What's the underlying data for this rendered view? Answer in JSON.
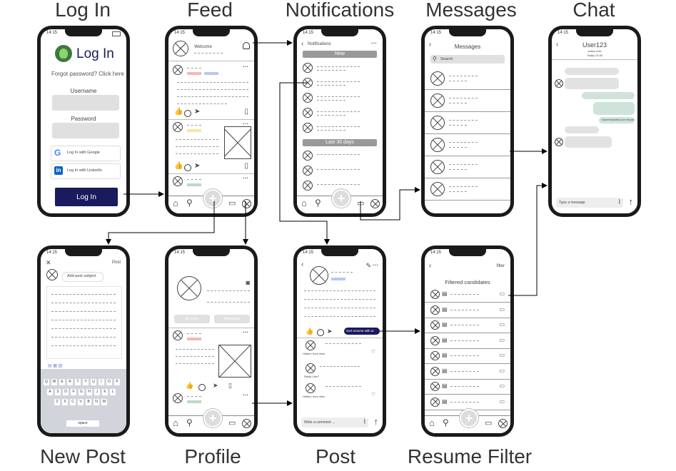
{
  "titles": {
    "login": "Log In",
    "feed": "Feed",
    "notifications": "Notifications",
    "messages": "Messages",
    "chat": "Chat",
    "new_post": "New Post",
    "profile": "Profile",
    "post": "Post",
    "resume_filter": "Resume Filter"
  },
  "status_time": "14:15",
  "login": {
    "title": "Log In",
    "forgot": "Forgot password? Click here",
    "username_label": "Username",
    "password_label": "Password",
    "google": "Log In with Google",
    "linkedin": "Log In with LinkedIn",
    "button": "Log In"
  },
  "feed": {
    "welcome": "Welcome"
  },
  "notifications": {
    "header": "Notifications",
    "new_label": "New",
    "last30_label": "Last 30 days"
  },
  "messages": {
    "header": "Messages",
    "search_placeholder": "Search"
  },
  "chat": {
    "user": "User123",
    "status": "active now",
    "day": "Today 14:40",
    "bubble_text": "I have forwarded your resume",
    "input_placeholder": "Type a message"
  },
  "new_post": {
    "post_label": "Post",
    "subject_placeholder": "Add post subject",
    "keyboard_rows": [
      [
        "Q",
        "W",
        "E",
        "R",
        "T",
        "Y",
        "U",
        "I",
        "O",
        "P"
      ],
      [
        "A",
        "S",
        "D",
        "F",
        "G",
        "H",
        "J",
        "K",
        "L"
      ],
      [
        "Z",
        "X",
        "C",
        "V",
        "B",
        "N",
        "M"
      ]
    ],
    "space_label": "space"
  },
  "profile": {
    "btn1": "My posts",
    "btn2": "Messages"
  },
  "post": {
    "sort_label": "Sort resume with ai",
    "comment1_label": "Hidden from view",
    "comment2_label": "Reply  Like?",
    "comment3_label": "Hidden from view",
    "comment_placeholder": "Write a comment ..."
  },
  "resume_filter": {
    "filter_label": "filter",
    "header": "Filtered candidates"
  },
  "tabs": [
    "Home",
    "Search",
    "",
    "Chat",
    "Profile"
  ],
  "colors": {
    "login_button": "#1a1a5e",
    "chat_green": "#cfe3da",
    "chat_gray": "#e2e2e2",
    "section_gray": "#9e9e9e",
    "tag_pink": "#f2b8b8",
    "tag_blue": "#b8c8f2",
    "tag_yellow": "#f5e7a0",
    "tag_green": "#bcd9c4",
    "sort_button": "#1a1a5e"
  },
  "icons": [
    "google-icon",
    "linkedin-icon",
    "bell-icon",
    "home-icon",
    "search-icon",
    "plus-icon",
    "chat-icon",
    "profile-icon",
    "like-icon",
    "comment-icon",
    "share-icon",
    "bookmark-icon",
    "camera-icon",
    "attach-icon",
    "send-icon",
    "edit-icon",
    "back-icon"
  ]
}
